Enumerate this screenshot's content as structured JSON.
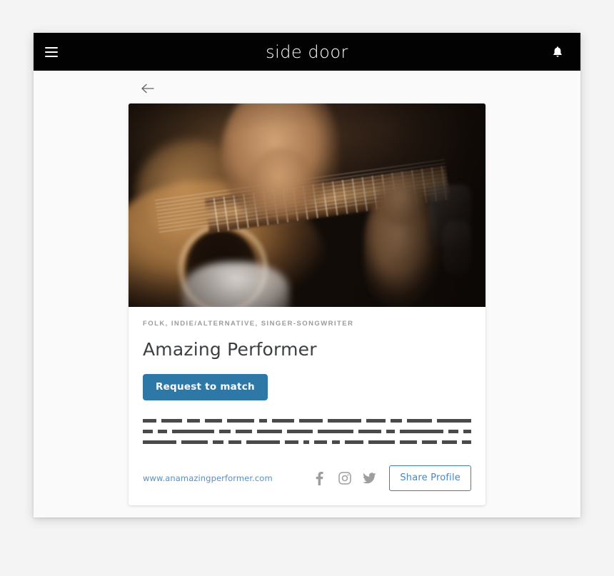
{
  "navbar": {
    "menu_icon": "hamburger-menu-icon",
    "logo": "side door",
    "notifications_icon": "bell-icon"
  },
  "page": {
    "back_icon": "arrow-left-icon"
  },
  "profile": {
    "hero_image_alt": "hands playing an acoustic guitar",
    "genres": "FOLK, INDIE/ALTERNATIVE, SINGER-SONGWRITER",
    "name": "Amazing Performer",
    "request_button": "Request to match",
    "bio_hidden": true,
    "bio_redacted_rows": [
      [
        24,
        36,
        22,
        30,
        48,
        14,
        38,
        42,
        58,
        34,
        20,
        44,
        60
      ],
      [
        16,
        14,
        66,
        18,
        26,
        40,
        40,
        56,
        36,
        14,
        68,
        16,
        12
      ],
      [
        56,
        44,
        18,
        22,
        56,
        22,
        10,
        22,
        12,
        32,
        44,
        28,
        26,
        24,
        16
      ]
    ],
    "website": "www.anamazingperformer.com",
    "social": [
      {
        "name": "facebook-icon",
        "label": "Facebook"
      },
      {
        "name": "instagram-icon",
        "label": "Instagram"
      },
      {
        "name": "twitter-icon",
        "label": "Twitter"
      }
    ],
    "share_button": "Share Profile"
  },
  "colors": {
    "navbar_bg": "#020202",
    "page_bg": "#fafafa",
    "card_bg": "#ffffff",
    "primary_button": "#2e78a8",
    "link": "#5b8fc0",
    "outline_button_border": "#3d7fb4",
    "genre_text": "#9b9b9b",
    "name_text": "#3c4043",
    "redacted_bar": "#4a4a4a"
  }
}
